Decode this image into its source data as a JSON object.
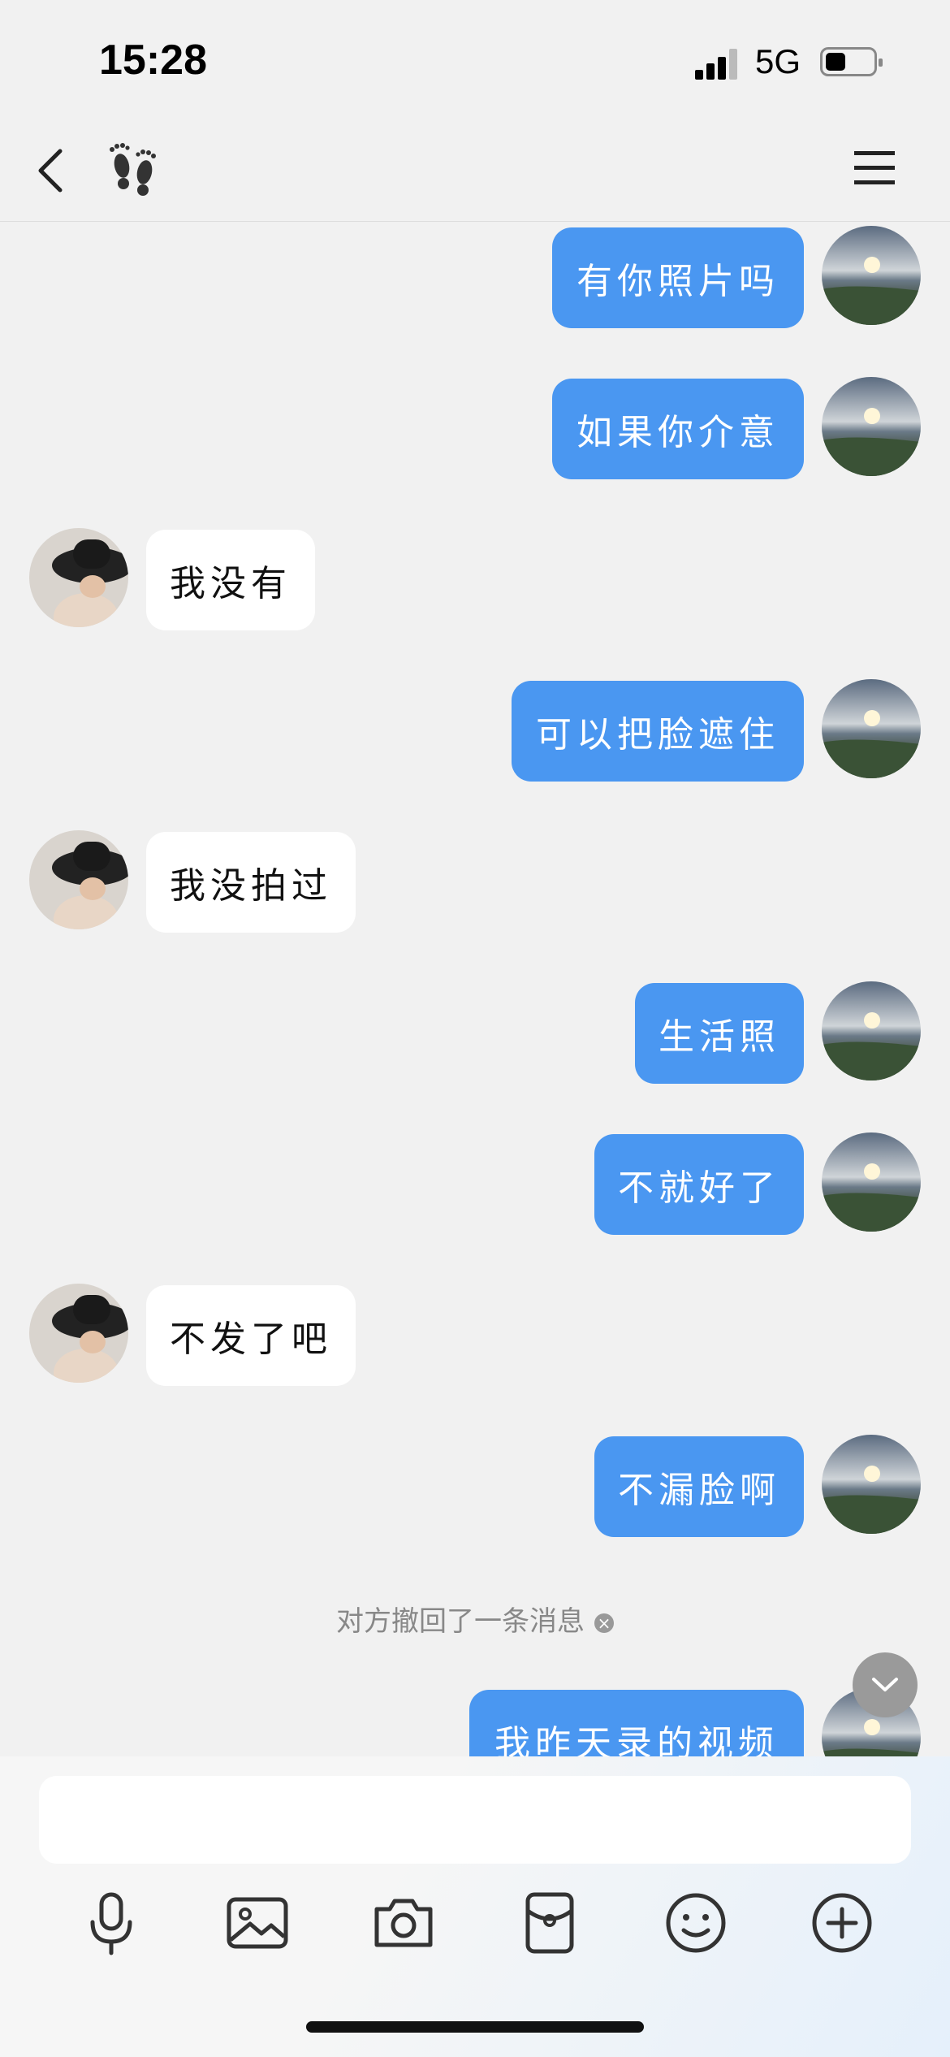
{
  "status": {
    "time": "15:28",
    "network": "5G"
  },
  "nav": {
    "back_icon": "back-chevron-icon",
    "title_icon": "footprint-icon",
    "menu_icon": "menu-icon"
  },
  "messages": [
    {
      "from": "me",
      "text": "有你照片吗"
    },
    {
      "from": "me",
      "text": "如果你介意"
    },
    {
      "from": "other",
      "text": "我没有"
    },
    {
      "from": "me",
      "text": "可以把脸遮住"
    },
    {
      "from": "other",
      "text": "我没拍过"
    },
    {
      "from": "me",
      "text": "生活照"
    },
    {
      "from": "me",
      "text": "不就好了"
    },
    {
      "from": "other",
      "text": "不发了吧"
    },
    {
      "from": "me",
      "text": "不漏脸啊"
    },
    {
      "from": "system",
      "text": "对方撤回了一条消息"
    },
    {
      "from": "me",
      "text": "我昨天录的视频"
    }
  ],
  "input": {
    "placeholder": ""
  },
  "toolbar": [
    "microphone-icon",
    "image-icon",
    "camera-icon",
    "red-packet-icon",
    "emoji-icon",
    "plus-icon"
  ],
  "colors": {
    "my_bubble": "#4a97f1",
    "their_bubble": "#ffffff",
    "background": "#f1f1f1"
  }
}
